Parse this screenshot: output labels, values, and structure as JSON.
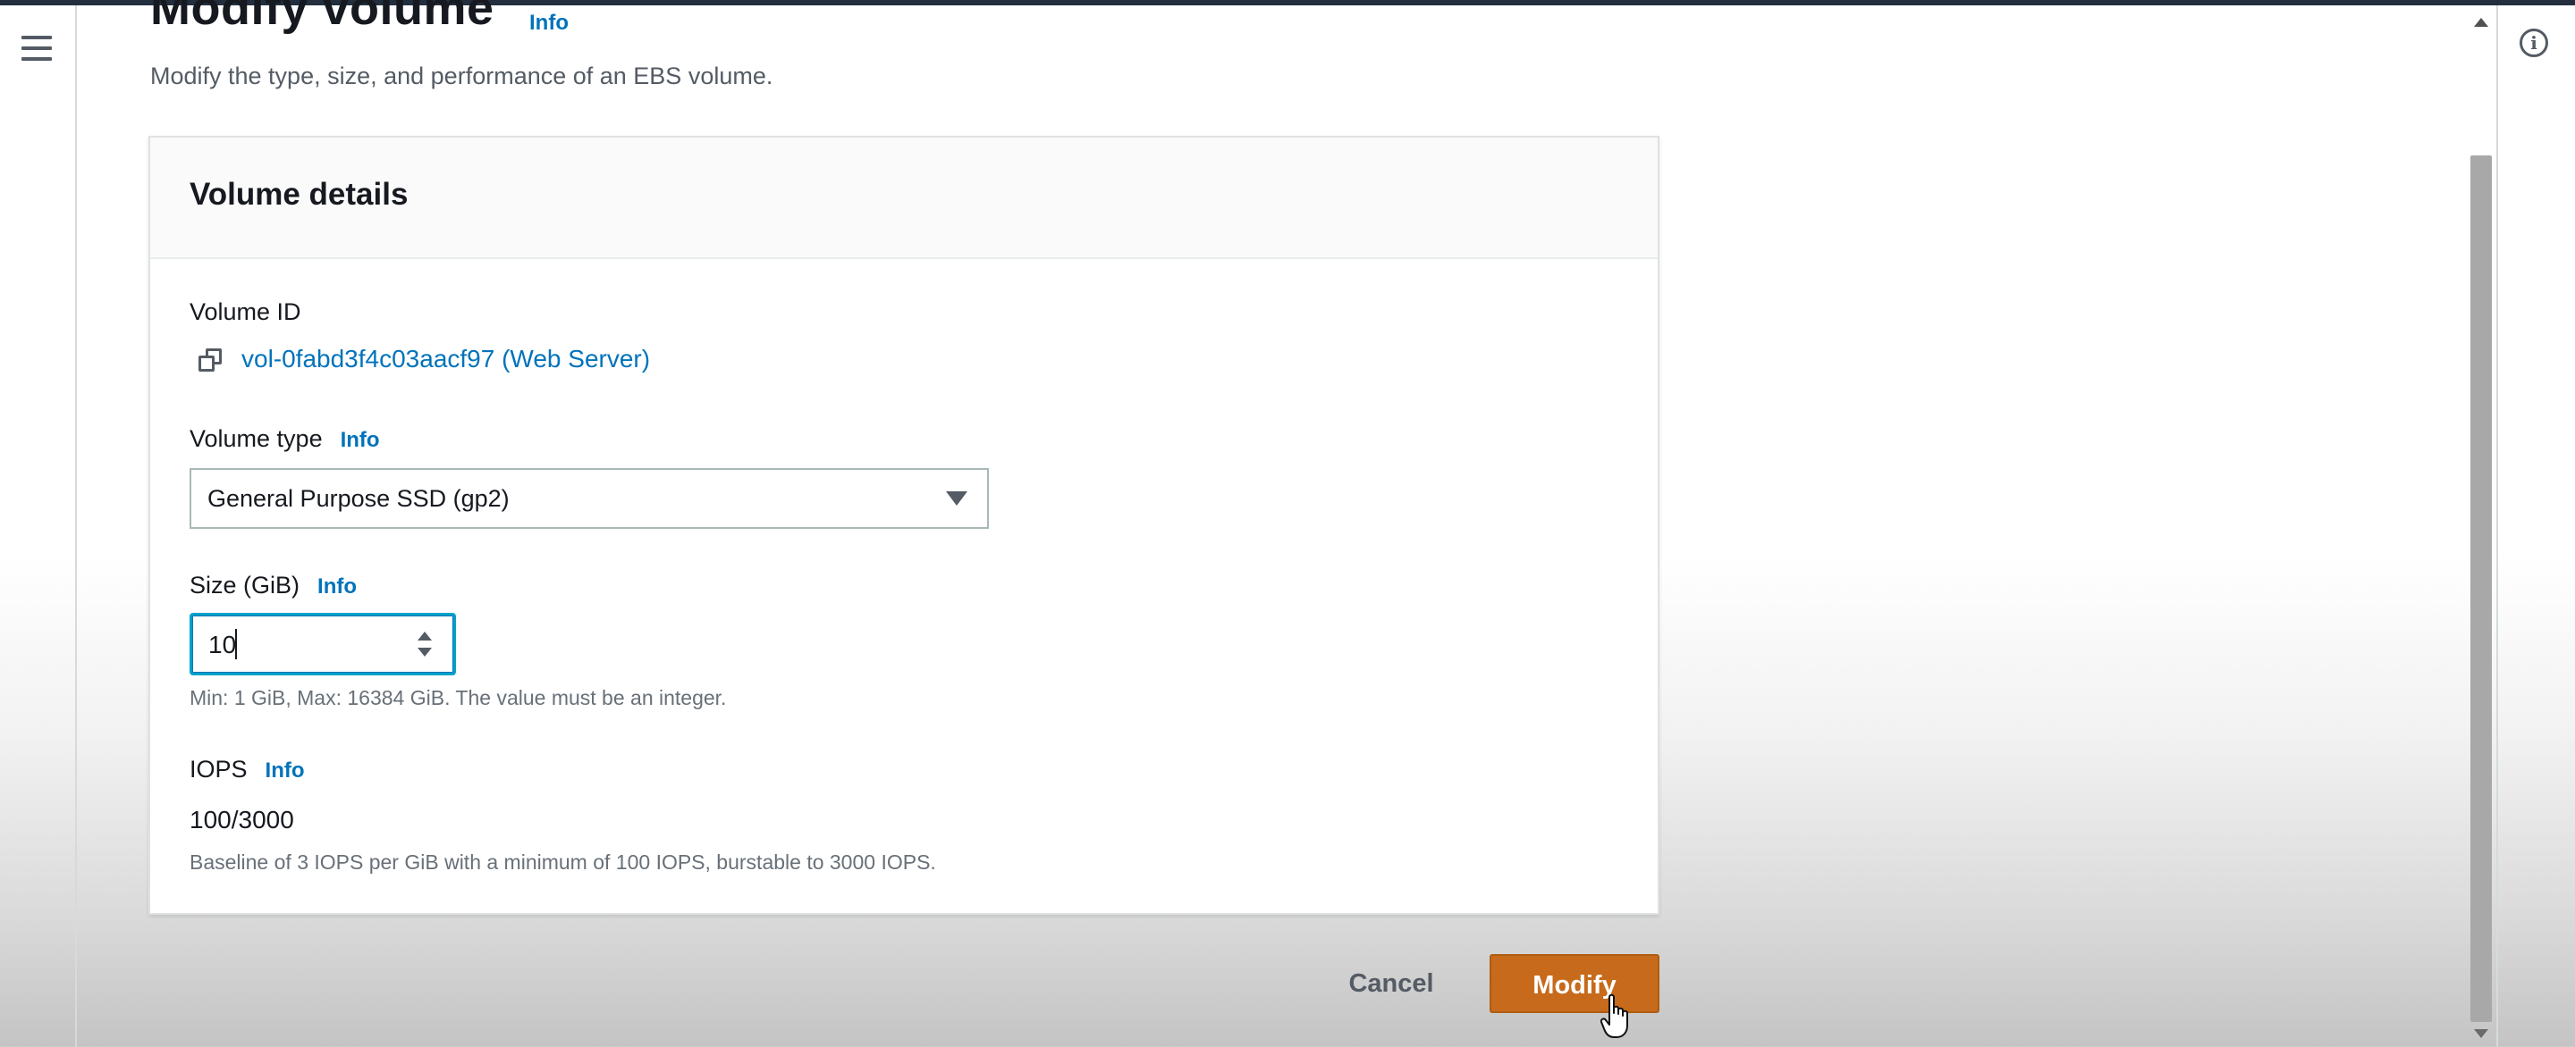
{
  "header": {
    "title": "Modify volume",
    "info_label": "Info",
    "description": "Modify the type, size, and performance of an EBS volume."
  },
  "card": {
    "title": "Volume details",
    "volume_id": {
      "label": "Volume ID",
      "value": "vol-0fabd3f4c03aacf97 (Web Server)"
    },
    "volume_type": {
      "label": "Volume type",
      "info_label": "Info",
      "selected": "General Purpose SSD (gp2)"
    },
    "size": {
      "label": "Size (GiB)",
      "info_label": "Info",
      "value": "10",
      "hint": "Min: 1 GiB, Max: 16384 GiB. The value must be an integer."
    },
    "iops": {
      "label": "IOPS",
      "info_label": "Info",
      "value": "100/3000",
      "hint": "Baseline of 3 IOPS per GiB with a minimum of 100 IOPS, burstable to 3000 IOPS."
    }
  },
  "actions": {
    "cancel_label": "Cancel",
    "modify_label": "Modify"
  },
  "colors": {
    "link": "#0073bb",
    "primary_button": "#c76a1b",
    "focus_border": "#00a1c9"
  },
  "icons": [
    "menu-icon",
    "info-circle-icon",
    "copy-icon",
    "caret-down-icon",
    "stepper-icon",
    "hand-cursor-icon"
  ]
}
